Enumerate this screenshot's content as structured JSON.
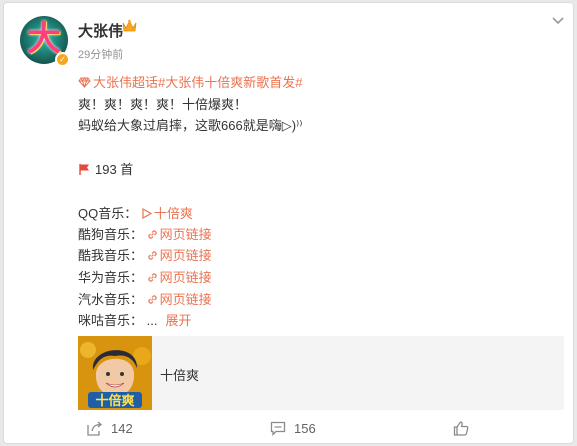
{
  "post": {
    "username": "大张伟",
    "time": "29分钟前",
    "topics": "大张伟超话#大张伟十倍爽新歌首发#",
    "line1": "爽！爽！爽！爽！十倍爆爽！",
    "line2": "蚂蚁给大象过肩摔，这歌666就是嗨▷)⁾⁾",
    "count": "193 首"
  },
  "songs": [
    {
      "label": "QQ音乐：",
      "link": "十倍爽",
      "icon": "play-icon"
    },
    {
      "label": "酷狗音乐：",
      "link": "网页链接",
      "icon": "link-icon"
    },
    {
      "label": "酷我音乐：",
      "link": "网页链接",
      "icon": "link-icon"
    },
    {
      "label": "华为音乐：",
      "link": "网页链接",
      "icon": "link-icon"
    },
    {
      "label": "汽水音乐：",
      "link": "网页链接",
      "icon": "link-icon"
    }
  ],
  "more_row": {
    "label": "咪咕音乐：",
    "dots": "...",
    "expand": "展开"
  },
  "music_card": {
    "title": "十倍爽"
  },
  "actions": {
    "share": "142",
    "comment": "156",
    "like": ""
  },
  "colors": {
    "link": "#eb7350",
    "text": "#333333",
    "muted": "#939393"
  }
}
